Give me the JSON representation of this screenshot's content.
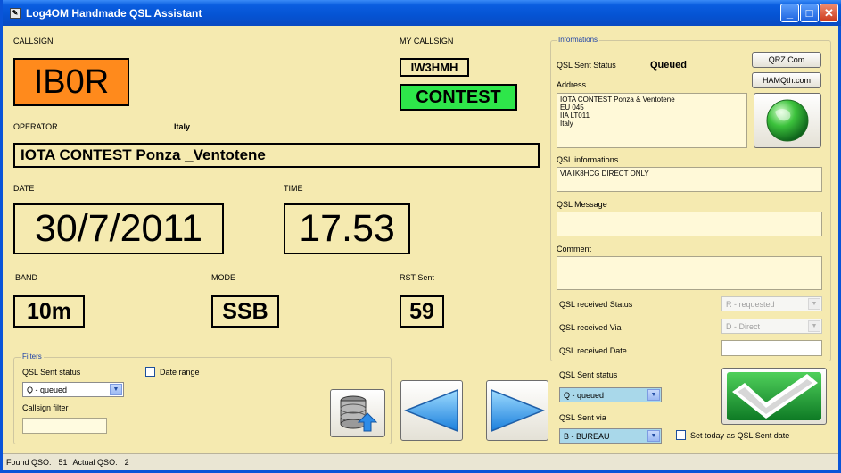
{
  "window": {
    "title": "Log4OM Handmade QSL Assistant"
  },
  "main": {
    "callsign_label": "CALLSIGN",
    "callsign": "IB0R",
    "my_callsign_label": "MY CALLSIGN",
    "my_callsign": "IW3HMH",
    "contest": "CONTEST",
    "operator_label": "OPERATOR",
    "country": "Italy",
    "operator_name": "IOTA CONTEST Ponza _Ventotene",
    "date_label": "DATE",
    "date": "30/7/2011",
    "time_label": "TIME",
    "time": "17.53",
    "band_label": "BAND",
    "band": "10m",
    "mode_label": "MODE",
    "mode": "SSB",
    "rst_label": "RST Sent",
    "rst": "59"
  },
  "filters": {
    "title": "Filters",
    "sent_status_label": "QSL Sent status",
    "sent_status_value": "Q - queued",
    "date_range_label": "Date range",
    "callsign_filter_label": "Callsign filter",
    "callsign_filter_value": ""
  },
  "info": {
    "title": "Informations",
    "sent_status_label": "QSL Sent Status",
    "sent_status_value": "Queued",
    "qrz_button": "QRZ.Com",
    "hamqth_button": "HAMQth.com",
    "address_label": "Address",
    "address_value": "IOTA CONTEST Ponza & Ventotene\nEU 045\nIIA LT011\nItaly",
    "qsl_info_label": "QSL informations",
    "qsl_info_value": "VIA IK8HCG DIRECT ONLY",
    "qsl_message_label": "QSL Message",
    "qsl_message_value": "",
    "comment_label": "Comment",
    "comment_value": "",
    "rcvd_status_label": "QSL received Status",
    "rcvd_status_value": "R - requested",
    "rcvd_via_label": "QSL received Via",
    "rcvd_via_value": "D - Direct",
    "rcvd_date_label": "QSL received Date",
    "rcvd_date_value": ""
  },
  "send": {
    "sent_status_label": "QSL Sent status",
    "sent_status_value": "Q - queued",
    "sent_via_label": "QSL Sent via",
    "sent_via_value": "B - BUREAU",
    "set_today_label": "Set today as QSL Sent date"
  },
  "status_bar": {
    "found_label": "Found QSO:",
    "found_value": "51",
    "actual_label": "Actual QSO:",
    "actual_value": "2"
  },
  "colors": {
    "background": "#f5eab0",
    "callsign_bg": "#ff8a1c",
    "contest_bg": "#2ee64a",
    "titlebar": "#0553d3"
  },
  "icons": [
    "database-upload-icon",
    "arrow-left-icon",
    "arrow-right-icon",
    "globe-icon",
    "checkmark-icon"
  ]
}
